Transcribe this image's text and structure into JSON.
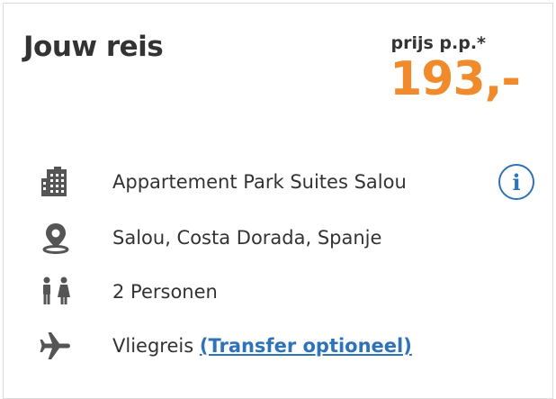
{
  "header": {
    "title": "Jouw reis",
    "price_label": "prijs p.p.*",
    "price_value": "193,-"
  },
  "details": [
    {
      "icon": "building-icon",
      "label": "Appartement Park Suites Salou"
    },
    {
      "icon": "location-pin-icon",
      "label": "Salou, Costa Dorada, Spanje"
    },
    {
      "icon": "persons-icon",
      "label": "2 Personen"
    },
    {
      "icon": "airplane-icon",
      "label": "Vliegreis",
      "link": "(Transfer optioneel)"
    }
  ],
  "info_icon": "i",
  "colors": {
    "accent_orange": "#f08a2a",
    "link_blue": "#2e73b8",
    "text": "#333333",
    "icon_gray": "#555555"
  }
}
